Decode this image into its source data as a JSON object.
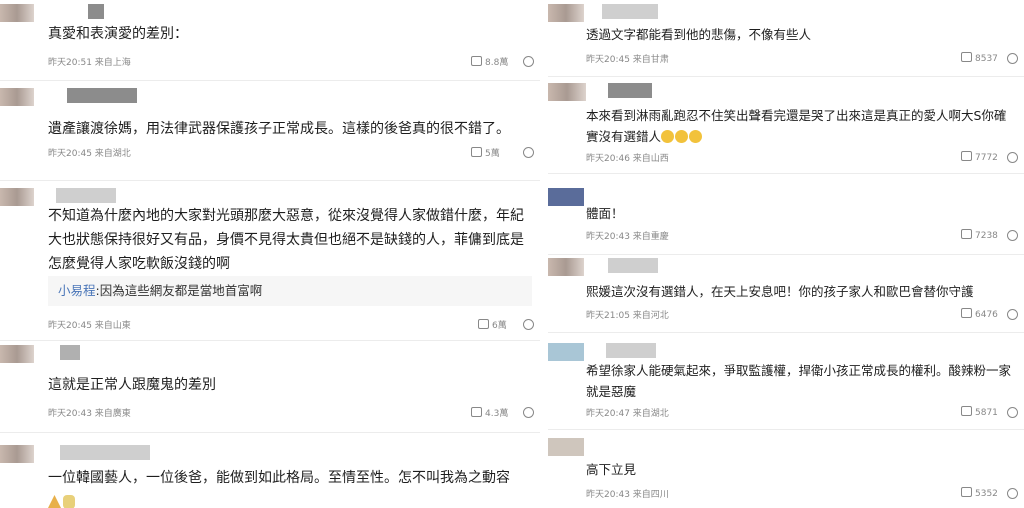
{
  "left_comments": [
    {
      "text": "真愛和表演愛的差別：",
      "time": "昨天20:51 来自上海",
      "likes": "8.8萬"
    },
    {
      "text": "遺產讓渡徐媽，用法律武器保護孩子正常成長。這樣的後爸真的很不錯了。",
      "time": "昨天20:45 来自湖北",
      "likes": "5萬"
    },
    {
      "text": "不知道為什麼內地的大家對光頭那麼大惡意，從來沒覺得人家做錯什麼，年紀大也狀態保持很好又有品，身價不見得太貴但也絕不是缺錢的人，菲傭到底是怎麼覺得人家吃軟飯沒錢的啊",
      "reply_name": "小易程",
      "reply_text": ":因為這些網友都是當地首富啊",
      "time": "昨天20:45 来自山東",
      "likes": "6萬"
    },
    {
      "text": "這就是正常人跟魔鬼的差別",
      "time": "昨天20:43 来自廣東",
      "likes": "4.3萬"
    },
    {
      "text": "一位韓國藝人，一位後爸，能做到如此格局。至情至性。怎不叫我為之動容"
    }
  ],
  "right_comments": [
    {
      "text": "透過文字都能看到他的悲傷，不像有些人",
      "time": "昨天20:45 来自甘肃",
      "likes": "8537"
    },
    {
      "text": "本來看到淋雨亂跑忍不住笑出聲看完還是哭了出來這是真正的愛人啊大S你確實沒有選錯人",
      "time": "昨天20:46 来自山西",
      "likes": "7772"
    },
    {
      "text": "體面！",
      "time": "昨天20:43 来自重慶",
      "likes": "7238"
    },
    {
      "text": "熙媛這次沒有選錯人，在天上安息吧！你的孩子家人和歐巴會替你守護",
      "time": "昨天21:05 来自河北",
      "likes": "6476"
    },
    {
      "text": "希望徐家人能硬氣起來，爭取監護權，捍衛小孩正常成長的權利。酸辣粉一家就是惡魔",
      "time": "昨天20:47 来自湖北",
      "likes": "5871"
    },
    {
      "text": "高下立見",
      "time": "昨天20:43 来自四川",
      "likes": "5352"
    }
  ],
  "icons": {
    "like": "thumbs-up-icon",
    "reply": "comment-bubble-icon"
  }
}
